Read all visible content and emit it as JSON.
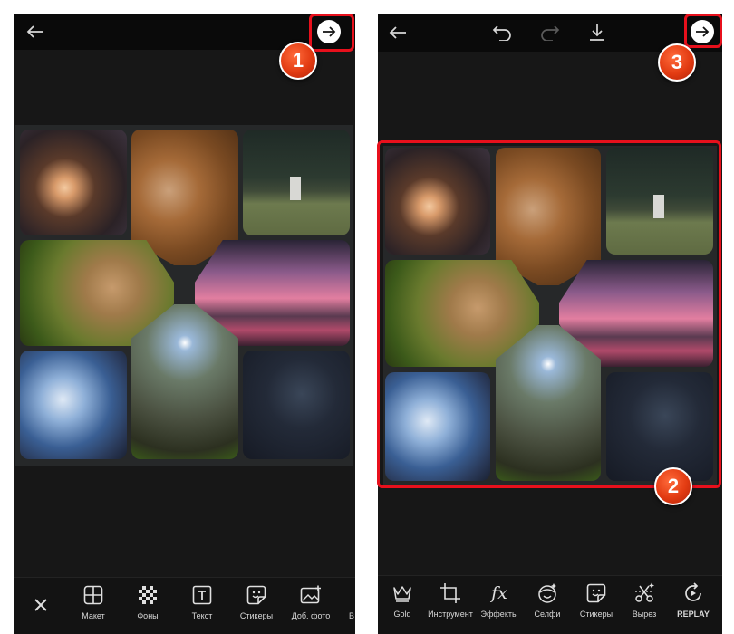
{
  "left_screen": {
    "toolbar": [
      {
        "label": "Макет",
        "icon": "layout-icon"
      },
      {
        "label": "Фоны",
        "icon": "checker-pattern-icon"
      },
      {
        "label": "Текст",
        "icon": "text-box-icon"
      },
      {
        "label": "Стикеры",
        "icon": "sticker-icon"
      },
      {
        "label": "Доб. фото",
        "icon": "add-photo-icon"
      },
      {
        "label": "В",
        "icon": "cut-off-item"
      }
    ]
  },
  "right_screen": {
    "toolbar": [
      {
        "label": "Gold",
        "icon": "crown-icon"
      },
      {
        "label": "Инструмент",
        "icon": "crop-icon"
      },
      {
        "label": "Эффекты",
        "icon": "fx-icon"
      },
      {
        "label": "Селфи",
        "icon": "selfie-icon"
      },
      {
        "label": "Стикеры",
        "icon": "sticker-icon"
      },
      {
        "label": "Вырез",
        "icon": "cutout-icon"
      },
      {
        "label": "REPLAY",
        "icon": "replay-icon"
      }
    ]
  },
  "callouts": [
    {
      "number": "1",
      "target": "next-button-left"
    },
    {
      "number": "2",
      "target": "collage-right"
    },
    {
      "number": "3",
      "target": "next-button-right"
    }
  ],
  "colors": {
    "callout_red": "#e8101c",
    "screen_bg": "#171717",
    "topbar_bg": "#0a0a0a",
    "collage_bg": "#262829"
  }
}
